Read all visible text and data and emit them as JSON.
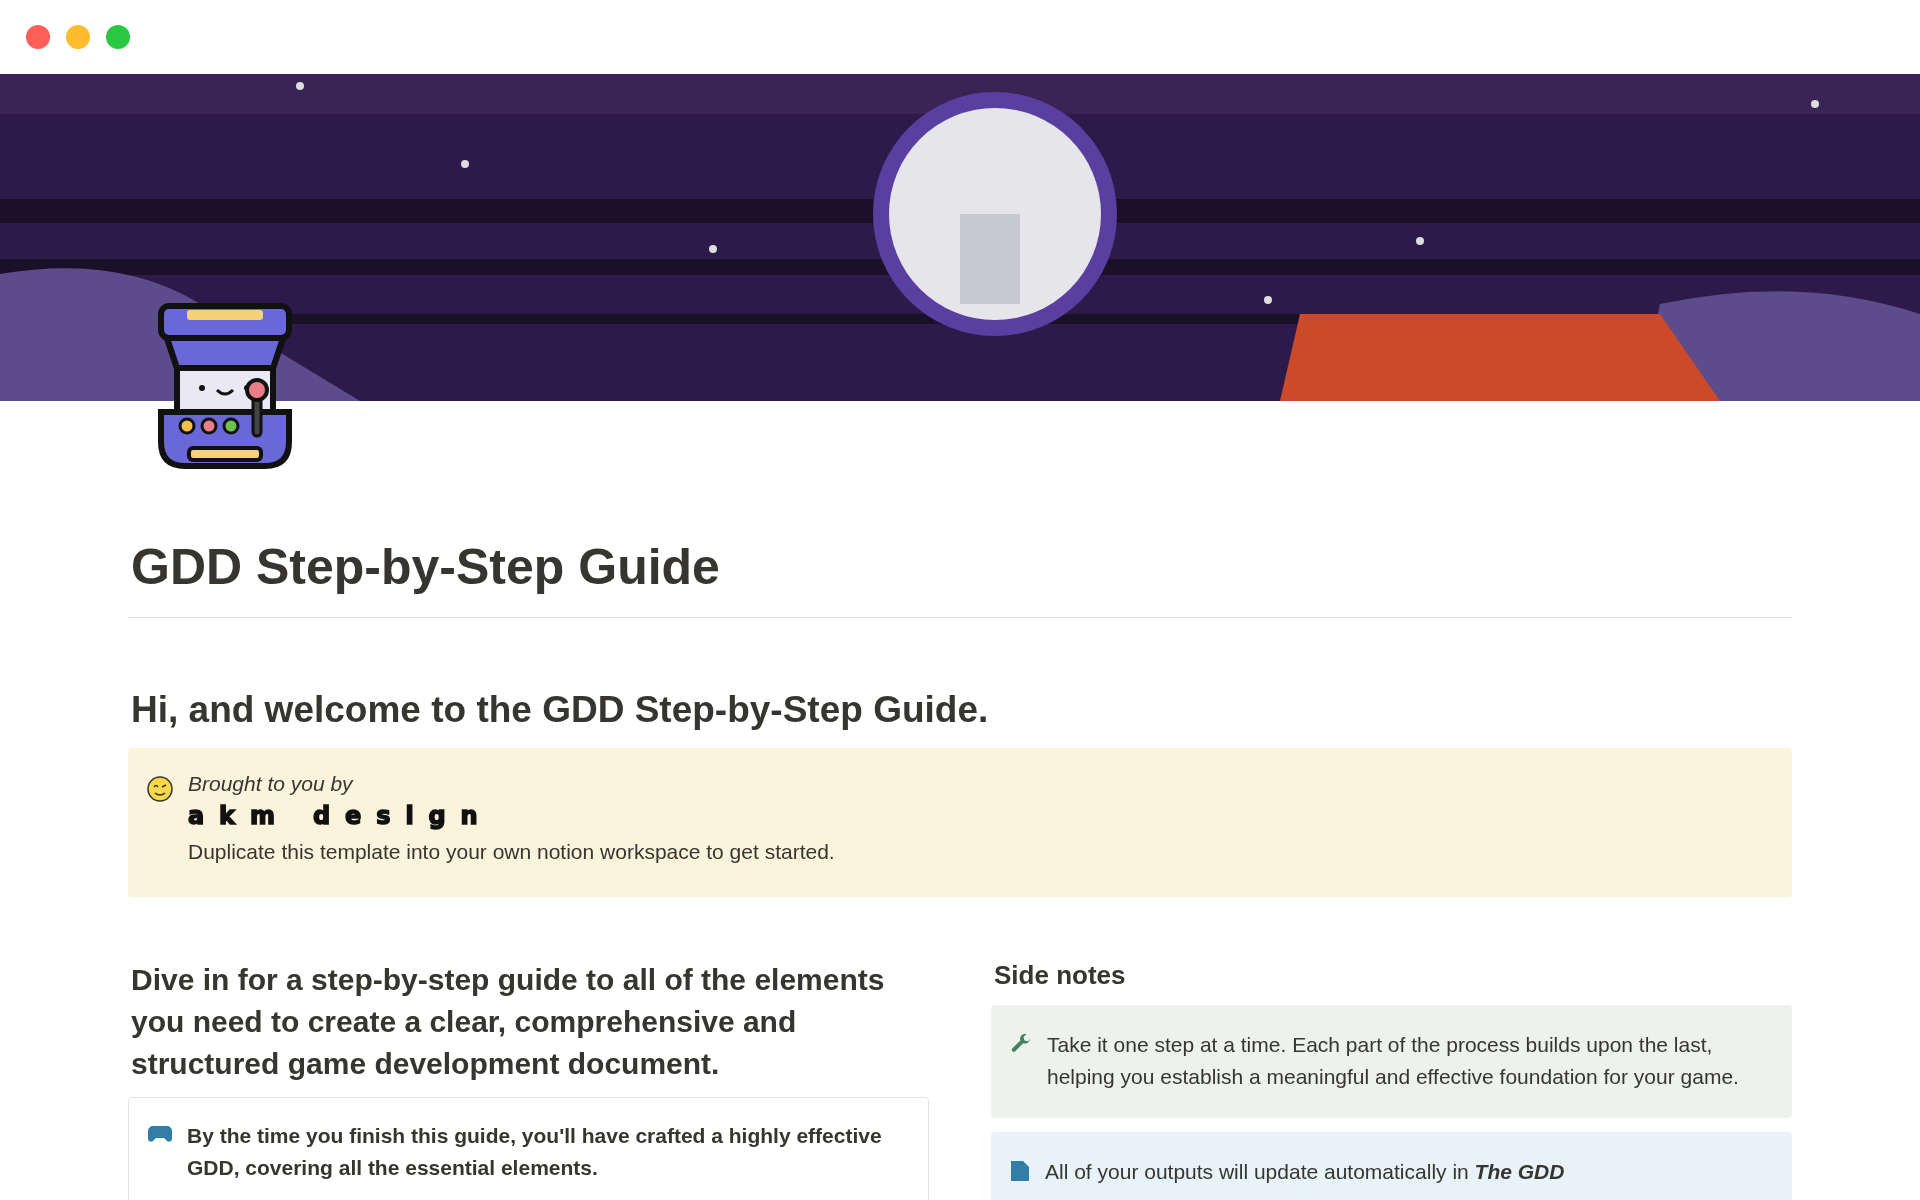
{
  "window": {
    "controls": [
      {
        "color": "#ff5f57"
      },
      {
        "color": "#febc2e"
      },
      {
        "color": "#28c840"
      }
    ]
  },
  "title": "GDD Step-by-Step Guide",
  "welcome_heading": "Hi, and welcome to the GDD Step-by-Step Guide.",
  "credit_callout": {
    "label": "Brought to you by",
    "brand": "akm design",
    "text": "Duplicate this template into your own notion workspace to get started."
  },
  "intro": {
    "heading": "Dive in for a step-by-step guide to all of the elements you need to create a clear, comprehensive and structured game development document.",
    "card": {
      "text": "By the time you finish this guide, you'll have crafted a highly effective GDD, covering all the essential elements."
    }
  },
  "side_notes": {
    "heading": "Side notes",
    "callouts": [
      {
        "kind": "tip",
        "text": "Take it one step at a time. Each part of the process builds upon the last, helping you establish a meaningful and effective foundation for your game."
      },
      {
        "kind": "info",
        "text": "All of your outputs will update automatically in",
        "link": "The GDD"
      }
    ]
  }
}
